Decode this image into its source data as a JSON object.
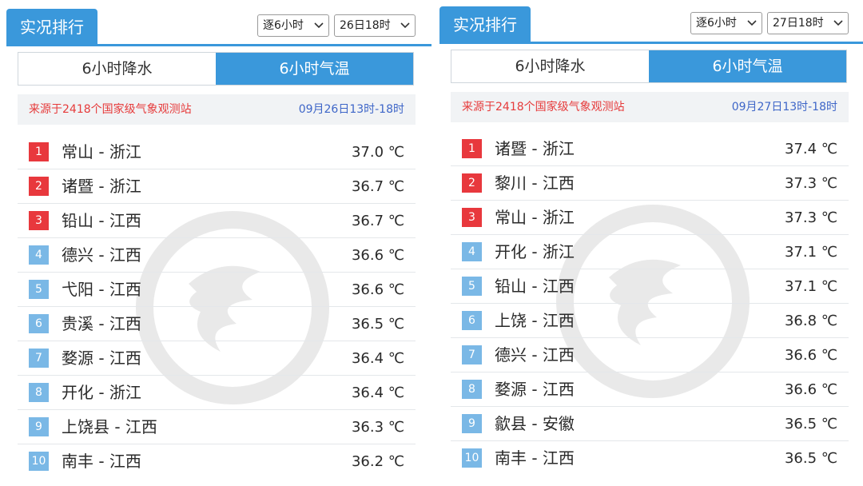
{
  "colors": {
    "accent": "#3a98db",
    "rank_top": "#e8383d",
    "rank_rest": "#7ab8e6",
    "source_red": "#e63b3b",
    "time_blue": "#3e66c8"
  },
  "panels": [
    {
      "title": "实况排行",
      "interval_select": "逐6小时",
      "time_select": "26日18时",
      "tabs": [
        {
          "label": "6小时降水",
          "active": false
        },
        {
          "label": "6小时气温",
          "active": true
        }
      ],
      "source_text": "来源于2418个国家级气象观测站",
      "period": "09月26日13时-18时",
      "rows": [
        {
          "rank": "1",
          "station": "常山 - 浙江",
          "temp": "37.0 ℃"
        },
        {
          "rank": "2",
          "station": "诸暨 - 浙江",
          "temp": "36.7 ℃"
        },
        {
          "rank": "3",
          "station": "铅山 - 江西",
          "temp": "36.7 ℃"
        },
        {
          "rank": "4",
          "station": "德兴 - 江西",
          "temp": "36.6 ℃"
        },
        {
          "rank": "5",
          "station": "弋阳 - 江西",
          "temp": "36.6 ℃"
        },
        {
          "rank": "6",
          "station": "贵溪 - 江西",
          "temp": "36.5 ℃"
        },
        {
          "rank": "7",
          "station": "婺源 - 江西",
          "temp": "36.4 ℃"
        },
        {
          "rank": "8",
          "station": "开化 - 浙江",
          "temp": "36.4 ℃"
        },
        {
          "rank": "9",
          "station": "上饶县 - 江西",
          "temp": "36.3 ℃"
        },
        {
          "rank": "10",
          "station": "南丰 - 江西",
          "temp": "36.2 ℃"
        }
      ]
    },
    {
      "title": "实况排行",
      "interval_select": "逐6小时",
      "time_select": "27日18时",
      "tabs": [
        {
          "label": "6小时降水",
          "active": false
        },
        {
          "label": "6小时气温",
          "active": true
        }
      ],
      "source_text": "来源于2418个国家级气象观测站",
      "period": "09月27日13时-18时",
      "rows": [
        {
          "rank": "1",
          "station": "诸暨 - 浙江",
          "temp": "37.4 ℃"
        },
        {
          "rank": "2",
          "station": "黎川 - 江西",
          "temp": "37.3 ℃"
        },
        {
          "rank": "3",
          "station": "常山 - 浙江",
          "temp": "37.3 ℃"
        },
        {
          "rank": "4",
          "station": "开化 - 浙江",
          "temp": "37.1 ℃"
        },
        {
          "rank": "5",
          "station": "铅山 - 江西",
          "temp": "37.1 ℃"
        },
        {
          "rank": "6",
          "station": "上饶 - 江西",
          "temp": "36.8 ℃"
        },
        {
          "rank": "7",
          "station": "德兴 - 江西",
          "temp": "36.6 ℃"
        },
        {
          "rank": "8",
          "station": "婺源 - 江西",
          "temp": "36.6 ℃"
        },
        {
          "rank": "9",
          "station": "歙县 - 安徽",
          "temp": "36.5 ℃"
        },
        {
          "rank": "10",
          "station": "南丰 - 江西",
          "temp": "36.5 ℃"
        }
      ]
    }
  ]
}
